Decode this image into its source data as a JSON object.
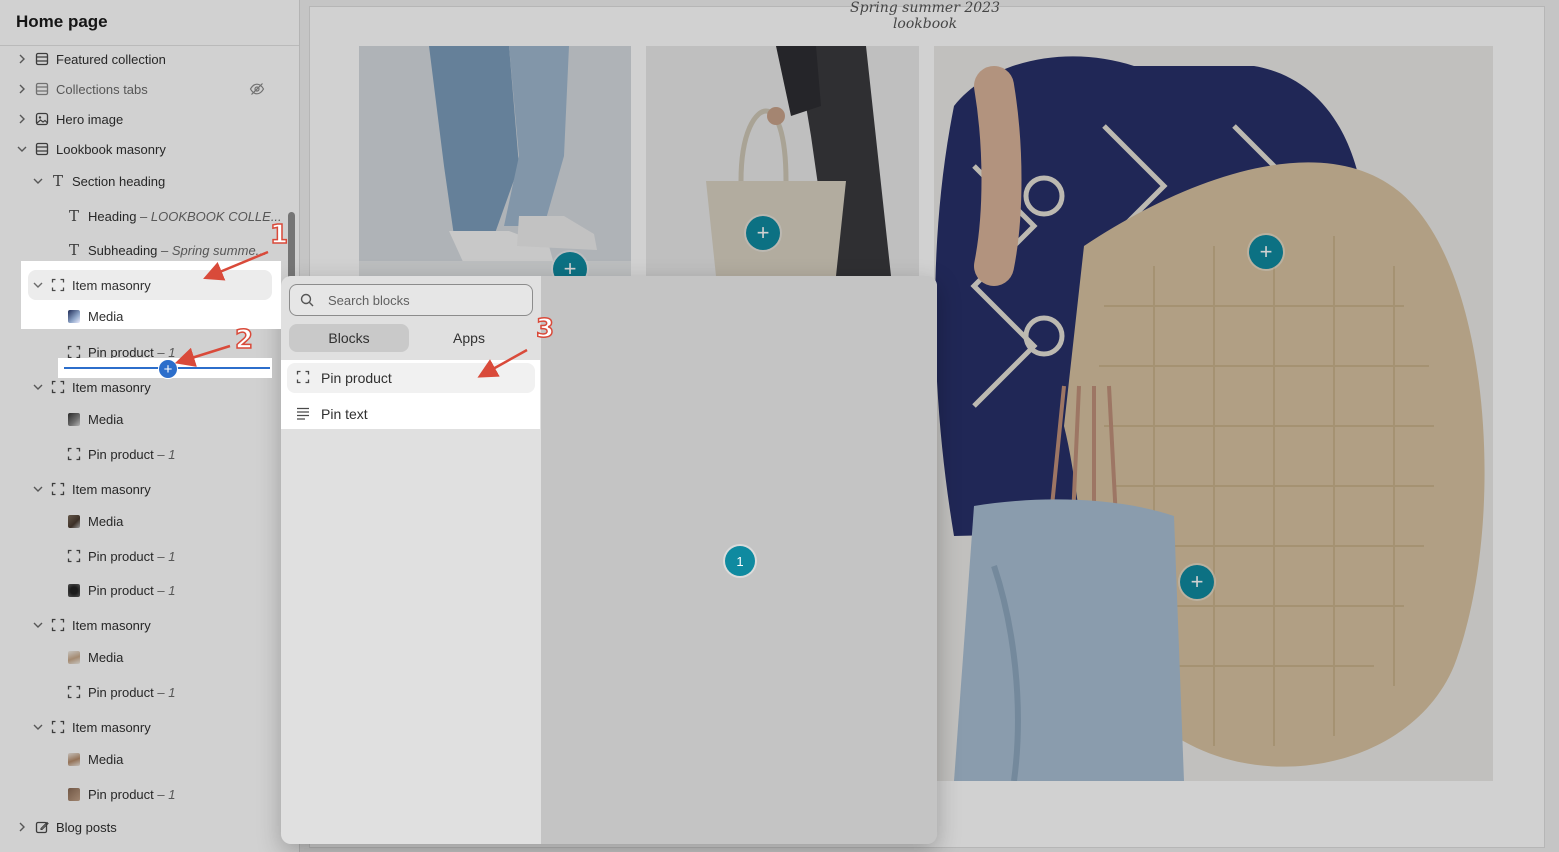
{
  "sidebar": {
    "title": "Home page",
    "rows": [
      {
        "label": "Featured collection"
      },
      {
        "label": "Collections tabs"
      },
      {
        "label": "Hero image"
      },
      {
        "label": "Lookbook masonry"
      },
      {
        "label": "Section heading"
      },
      {
        "label": "Heading",
        "sub": " – LOOKBOOK COLLE..."
      },
      {
        "label": "Subheading",
        "sub": " – Spring summe..."
      },
      {
        "label": "Item masonry"
      },
      {
        "label": "Media"
      },
      {
        "label": "Pin product",
        "sub": " – 1"
      },
      {
        "label": "Item masonry"
      },
      {
        "label": "Media"
      },
      {
        "label": "Pin product",
        "sub": " – 1"
      },
      {
        "label": "Item masonry"
      },
      {
        "label": "Media"
      },
      {
        "label": "Pin product",
        "sub": " – 1"
      },
      {
        "label": "Pin product",
        "sub": " – 1"
      },
      {
        "label": "Item masonry"
      },
      {
        "label": "Media"
      },
      {
        "label": "Pin product",
        "sub": " – 1"
      },
      {
        "label": "Item masonry"
      },
      {
        "label": "Media"
      },
      {
        "label": "Pin product",
        "sub": " – 1"
      },
      {
        "label": "Blog posts"
      }
    ]
  },
  "preview": {
    "caption": "Spring summer 2023 lookbook",
    "hotspot_plus": "+",
    "hotspot_number": "1"
  },
  "picker": {
    "search_placeholder": "Search blocks",
    "tabs": [
      "Blocks",
      "Apps"
    ],
    "items": [
      "Pin product",
      "Pin text"
    ]
  },
  "annotations": [
    "1",
    "2",
    "3"
  ],
  "colors": {
    "hotspot": "#0f8aa0",
    "insert_line": "#2c6ecb",
    "annotation": "#d94a3a"
  }
}
